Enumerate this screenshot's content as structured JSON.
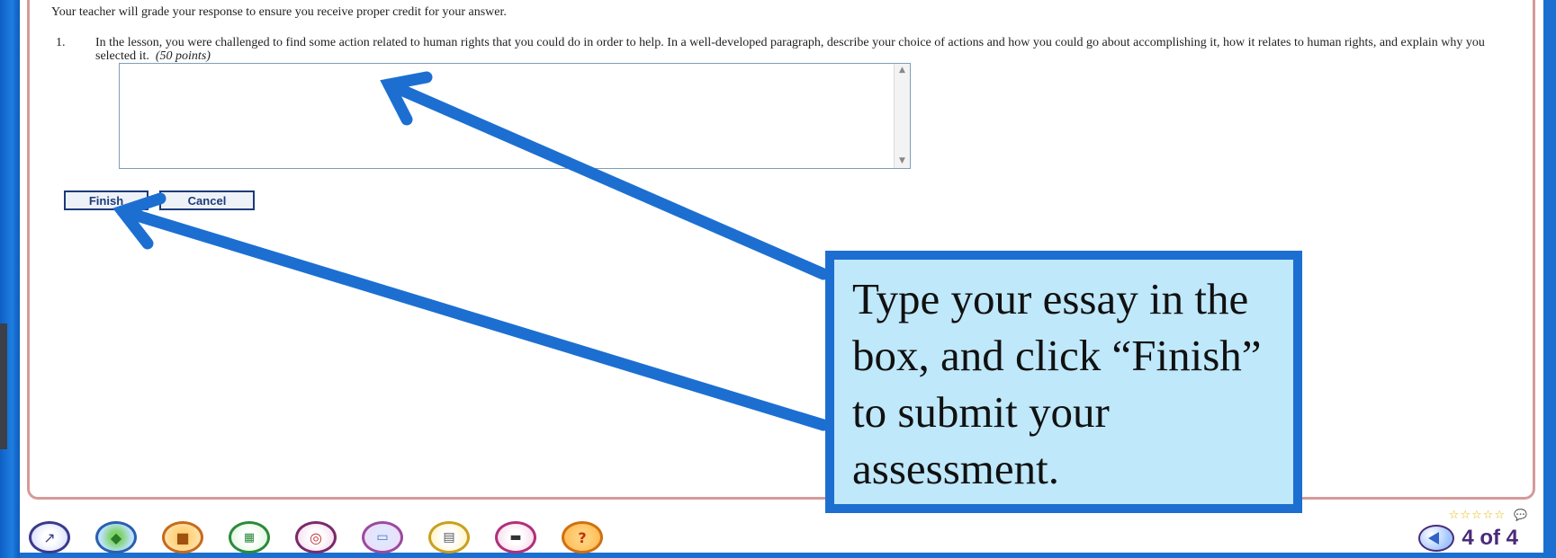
{
  "assignment": {
    "intro_text": "Your teacher will grade your response to ensure you receive proper credit for your answer.",
    "question_number": "1.",
    "question_text": "In the lesson, you were challenged to find some action related to human rights that you could do in order to help. In a well-developed paragraph, describe your choice of actions and how you could go about accomplishing it, how it relates to human rights, and explain why you selected it.",
    "question_points": "(50 points)",
    "essay_value": ""
  },
  "buttons": {
    "finish_label": "Finish",
    "cancel_label": "Cancel"
  },
  "toolbar": {
    "icons": [
      "compass-icon",
      "globe-icon",
      "backpack-icon",
      "calculator-icon",
      "target-icon",
      "window-icon",
      "printer-icon",
      "toolbox-icon",
      "help-icon"
    ],
    "rating_stars": "☆☆☆☆☆",
    "page_counter": "4 of 4"
  },
  "callout": {
    "text": "Type your essay in the box, and click “Finish” to submit your assessment.",
    "border_color": "#1c6fd1",
    "fill_color": "#bfe8fa"
  },
  "colors": {
    "frame_blue": "#1a6fd0",
    "content_border": "#d69a9a",
    "button_navy": "#1d3a7a",
    "pager_purple": "#4a2a7a"
  }
}
